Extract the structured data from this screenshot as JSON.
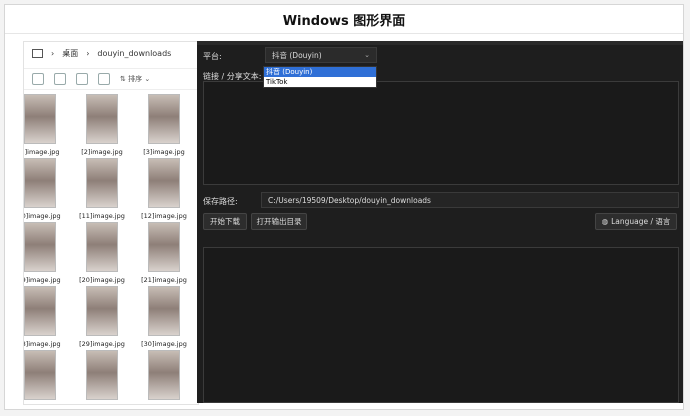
{
  "window_title": "Windows 图形界面",
  "explorer": {
    "breadcrumb": [
      "桌面",
      "douyin_downloads"
    ],
    "sort_label": "排序",
    "files": [
      "1]image.jpg",
      "[2]image.jpg",
      "[3]image.jpg",
      ":0]image.jpg",
      "[11]image.jpg",
      "[12]image.jpg",
      ":9]image.jpg",
      "[20]image.jpg",
      "[21]image.jpg",
      ":8]image.jpg",
      "[29]image.jpg",
      "[30]image.jpg",
      "",
      "",
      ""
    ]
  },
  "app": {
    "platform_label": "平台:",
    "platform_value": "抖音 (Douyin)",
    "platform_options": [
      "抖音 (Douyin)",
      "TikTok"
    ],
    "link_label": "链接 / 分享文本:",
    "save_label": "保存路径:",
    "save_path": "C:/Users/19509/Desktop/douyin_downloads",
    "start_button": "开始下载",
    "open_dir_button": "打开输出目录",
    "language_button": "Language / 语言"
  }
}
